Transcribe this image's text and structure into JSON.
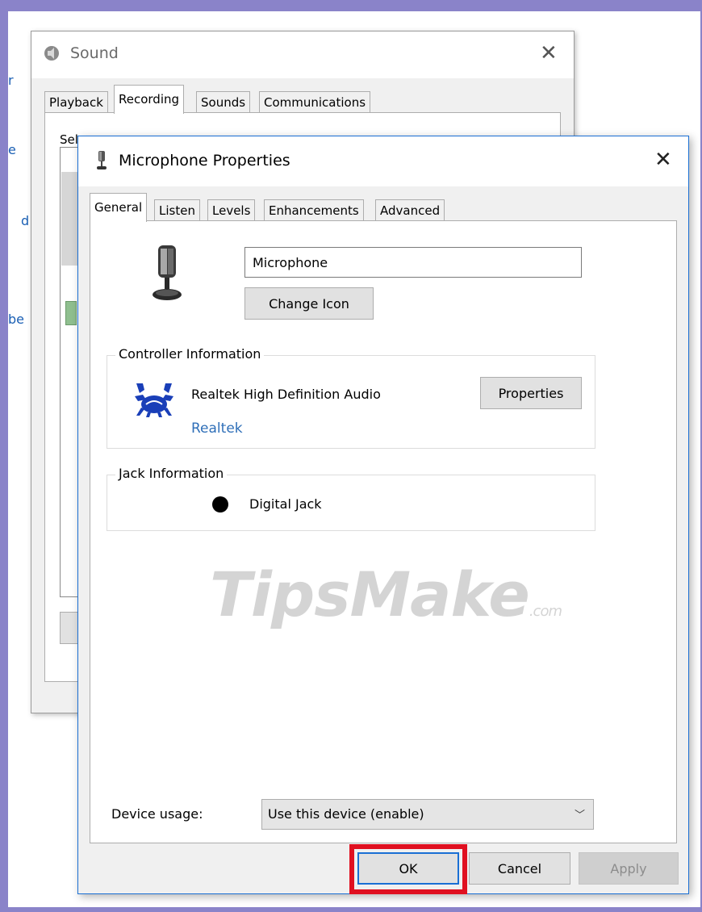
{
  "background_fragments": [
    "r",
    "e",
    "d",
    "be"
  ],
  "sound_window": {
    "title": "Sound",
    "tabs": [
      "Playback",
      "Recording",
      "Sounds",
      "Communications"
    ],
    "active_tab": "Recording",
    "partial_text": "Sel"
  },
  "dialog": {
    "title": "Microphone Properties",
    "tabs": [
      "General",
      "Listen",
      "Levels",
      "Enhancements",
      "Advanced"
    ],
    "active_tab": "General",
    "device_name": "Microphone",
    "change_icon_label": "Change Icon",
    "controller": {
      "legend": "Controller Information",
      "name": "Realtek High Definition Audio",
      "link": "Realtek",
      "properties_label": "Properties"
    },
    "jack": {
      "legend": "Jack Information",
      "name": "Digital Jack"
    },
    "device_usage": {
      "label": "Device usage:",
      "selected": "Use this device (enable)"
    },
    "buttons": {
      "ok": "OK",
      "cancel": "Cancel",
      "apply": "Apply"
    }
  },
  "watermark": {
    "main": "TipsMake",
    "suffix": ".com"
  },
  "colors": {
    "frame": "#8a83c9",
    "focus_blue": "#1a6fd4",
    "link": "#2f6fb8",
    "highlight_red": "#e01020"
  },
  "icons": {
    "sound_window": "speaker-icon",
    "dialog_window": "microphone-icon",
    "device": "microphone-icon",
    "controller": "realtek-crab-logo",
    "jack": "jack-dot-icon",
    "close": "close-icon",
    "dropdown": "chevron-down-icon"
  }
}
